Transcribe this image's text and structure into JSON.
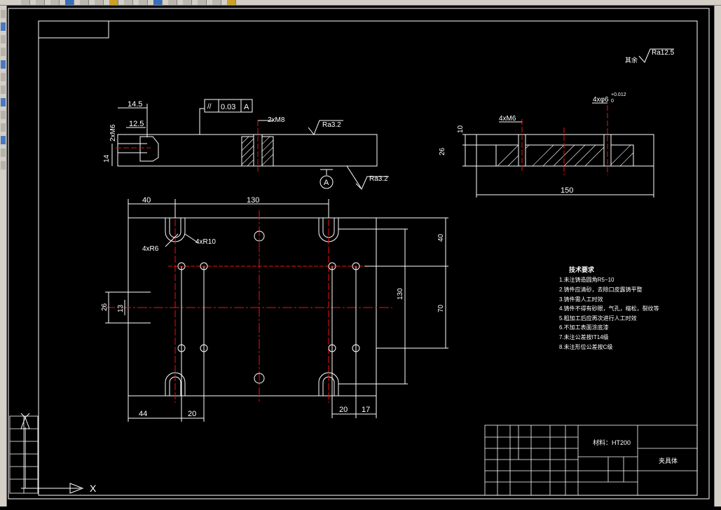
{
  "toolbar": {
    "icons": [
      "new-icon",
      "open-icon",
      "save-icon",
      "print-icon",
      "cut-icon",
      "copy-icon",
      "paste-icon",
      "undo-icon",
      "redo-icon",
      "pan-icon",
      "zoom-icon",
      "zoom-window-icon",
      "zoom-previous-icon",
      "properties-icon",
      "layer-icon"
    ]
  },
  "drawing": {
    "roughness_general": "Ra12.5",
    "roughness_general_label": "其余",
    "flatness_tolerance": "0.03",
    "datum_ref": "A",
    "datum_mark": "A",
    "roughness_top": "Ra3.2",
    "roughness_bottom": "Ra3.2",
    "side_dims": {
      "d1": "14.5",
      "d2": "12.5",
      "d3": "2xM6",
      "d4": "14"
    },
    "thread_label": "2xM8",
    "right_dims": {
      "holes": "4xM6",
      "pin": "4xφ6",
      "tol_upper": "+0.012",
      "tol_lower": "0",
      "h1": "10",
      "h2": "26",
      "w": "150"
    },
    "plan_dims": {
      "top_left": "40",
      "top_span": "130",
      "slot_r": "4xR10",
      "slot_w": "4xR6",
      "left_h1": "26",
      "left_h2": "13",
      "right_v1": "40",
      "right_v2": "130",
      "right_v3": "70",
      "bottom_1": "44",
      "bottom_2": "20",
      "bottom_3": "20",
      "bottom_4": "17"
    },
    "tech_notes": {
      "title": "技术要求",
      "lines": [
        "1.未注铸造圆角R5~10",
        "2.铸件应清砂，去除口皮露铸平整",
        "3.铸件需人工时效",
        "4.铸件不得有砂眼，气孔，缩松，裂纹等",
        "5.粗加工后应再次进行人工时效",
        "6.不加工表面涂底漆",
        "7.未注公差按IT14级",
        "8.未注形位公差按C级"
      ]
    },
    "title_block": {
      "material_label": "材料：HT200",
      "part_name": "夹具体"
    }
  }
}
